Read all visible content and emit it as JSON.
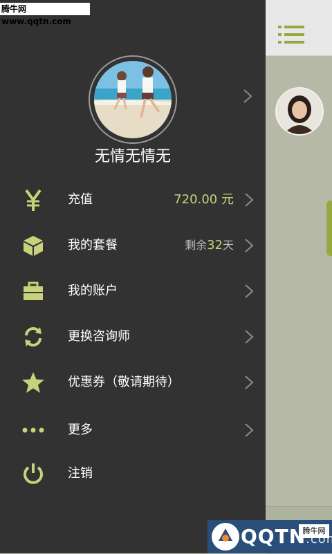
{
  "watermark_top": "腾牛网 www.qqtn.com",
  "profile": {
    "username": "无情无情无"
  },
  "menu": [
    {
      "key": "recharge",
      "label": "充值",
      "value": "720.00 元",
      "icon": "yen-icon"
    },
    {
      "key": "package",
      "label": "我的套餐",
      "remain_prefix": "剩余",
      "remain_num": "32",
      "remain_suffix": "天",
      "icon": "cube-icon"
    },
    {
      "key": "account",
      "label": "我的账户",
      "icon": "briefcase-icon"
    },
    {
      "key": "change_consultant",
      "label": "更换咨询师",
      "icon": "refresh-icon"
    },
    {
      "key": "coupon",
      "label": "优惠券（敬请期待）",
      "icon": "star-icon"
    },
    {
      "key": "more",
      "label": "更多",
      "icon": "more-dots-icon"
    },
    {
      "key": "logout",
      "label": "注销",
      "icon": "power-icon"
    }
  ],
  "watermark_bottom": {
    "brand": "QQTN",
    "suffix": ".com",
    "tag": "腾牛网"
  },
  "colors": {
    "drawer_bg": "#323232",
    "accent": "#c7d27a",
    "brand_green": "#97a843"
  }
}
